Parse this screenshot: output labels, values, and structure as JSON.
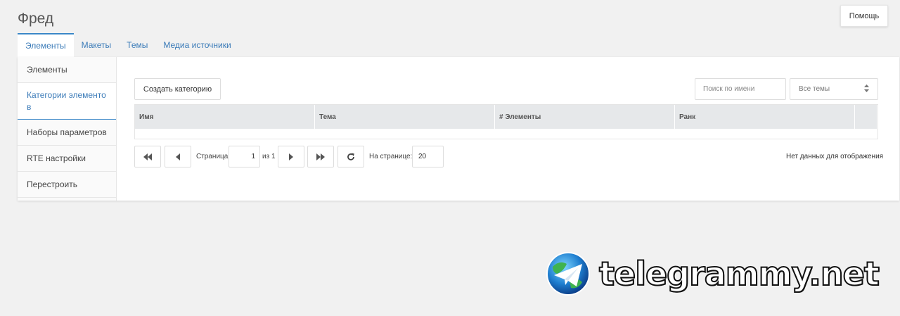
{
  "header": {
    "title": "Фред",
    "help_label": "Помощь"
  },
  "tabs": [
    {
      "label": "Элементы",
      "active": true
    },
    {
      "label": "Макеты",
      "active": false
    },
    {
      "label": "Темы",
      "active": false
    },
    {
      "label": "Медиа источники",
      "active": false
    }
  ],
  "sidebar": {
    "items": [
      {
        "label": "Элементы"
      },
      {
        "label": "Категории элементо в",
        "active": true
      },
      {
        "label": "Наборы параметров"
      },
      {
        "label": "RTE настройки"
      },
      {
        "label": "Перестроить"
      }
    ]
  },
  "toolbar": {
    "create_label": "Создать категорию",
    "search_placeholder": "Поиск по имени",
    "theme_select_value": "Все темы"
  },
  "grid": {
    "columns": [
      "Имя",
      "Тема",
      "# Элементы",
      "Ранк"
    ]
  },
  "pager": {
    "page_label": "Страница",
    "page_value": "1",
    "of_label": "из 1",
    "per_page_label": "На странице:",
    "per_page_value": "20",
    "empty_text": "Нет данных для отображения"
  },
  "watermark": {
    "text": "telegrammy.net"
  },
  "colors": {
    "accent": "#3b88c8",
    "link": "#3b7bb8",
    "background": "#f1f1f1",
    "grid_header": "#e6e8ea"
  }
}
